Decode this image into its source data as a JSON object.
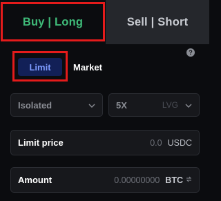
{
  "tabs": {
    "buy_label": "Buy | Long",
    "sell_label": "Sell | Short"
  },
  "order_types": {
    "limit_label": "Limit",
    "market_label": "Market"
  },
  "help": {
    "icon_glyph": "?"
  },
  "margin_mode": {
    "value": "Isolated",
    "icon": "chevron-down-icon"
  },
  "leverage": {
    "value": "5X",
    "unit": "LVG",
    "icon": "chevron-down-icon"
  },
  "limit_price": {
    "label": "Limit price",
    "value": "0.0",
    "unit": "USDC"
  },
  "amount": {
    "label": "Amount",
    "value": "0.00000000",
    "unit": "BTC",
    "icon": "swap-icon"
  },
  "colors": {
    "buy_green": "#3fbb79",
    "highlight_red": "#e41b1b",
    "limit_bg": "#122057",
    "limit_text": "#7e9cff"
  }
}
